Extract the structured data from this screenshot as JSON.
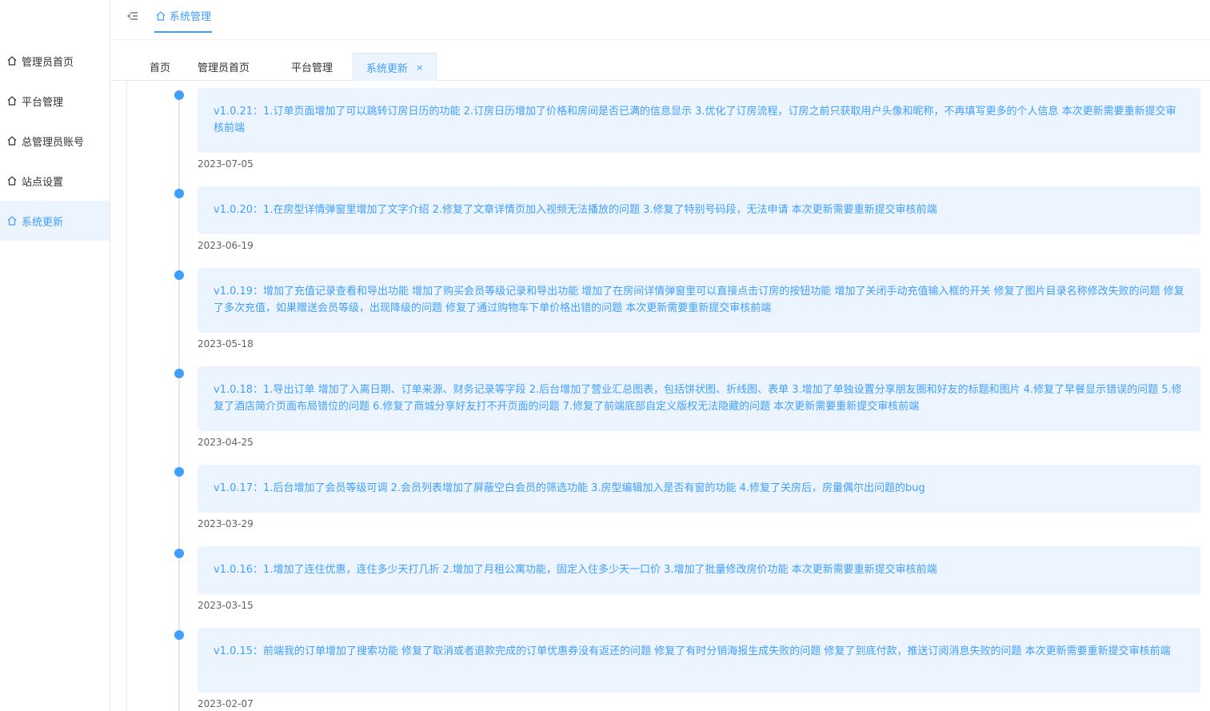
{
  "sidebar": {
    "items": [
      {
        "label": "管理员首页"
      },
      {
        "label": "平台管理"
      },
      {
        "label": "总管理员账号"
      },
      {
        "label": "站点设置"
      },
      {
        "label": "系统更新"
      }
    ],
    "active_index": 4
  },
  "topbar": {
    "tab_label": "系统管理"
  },
  "tags": {
    "items": [
      {
        "label": "首页"
      },
      {
        "label": "管理员首页"
      },
      {
        "label": "平台管理"
      },
      {
        "label": "系统更新"
      }
    ],
    "close_glyph": "×"
  },
  "timeline": [
    {
      "text": "v1.0.21：1.订单页面增加了可以跳转订房日历的功能 2.订房日历增加了价格和房间是否已满的信息显示 3.优化了订房流程，订房之前只获取用户头像和昵称，不再填写更多的个人信息 本次更新需要重新提交审核前端",
      "date": "2023-07-05"
    },
    {
      "text": "v1.0.20：1.在房型详情弹窗里增加了文字介绍 2.修复了文章详情页加入视频无法播放的问题 3.修复了特别号码段，无法申请 本次更新需要重新提交审核前端",
      "date": "2023-06-19"
    },
    {
      "text": "v1.0.19：增加了充值记录查看和导出功能 增加了购买会员等级记录和导出功能 增加了在房间详情弹窗里可以直接点击订房的按钮功能 增加了关闭手动充值输入框的开关 修复了图片目录名称修改失败的问题 修复了多次充值，如果赠送会员等级，出现降级的问题 修复了通过购物车下单价格出错的问题 本次更新需要重新提交审核前端",
      "date": "2023-05-18"
    },
    {
      "text": "v1.0.18：1.导出订单 增加了入离日期、订单来源、财务记录等字段 2.后台增加了营业汇总图表，包括饼状图、折线图、表单 3.增加了单独设置分享朋友圈和好友的标题和图片 4.修复了早餐显示错误的问题 5.修复了酒店简介页面布局错位的问题 6.修复了商城分享好友打不开页面的问题 7.修复了前端底部自定义版权无法隐藏的问题 本次更新需要重新提交审核前端",
      "date": "2023-04-25"
    },
    {
      "text": "v1.0.17：1.后台增加了会员等级可调 2.会员列表增加了屏蔽空白会员的筛选功能 3.房型编辑加入是否有窗的功能 4.修复了关房后，房量偶尔出问题的bug",
      "date": "2023-03-29"
    },
    {
      "text": "v1.0.16：1.增加了连住优惠，连住多少天打几折 2.增加了月租公寓功能，固定入住多少天一口价 3.增加了批量修改房价功能 本次更新需要重新提交审核前端",
      "date": "2023-03-15"
    },
    {
      "text": "v1.0.15：前端我的订单增加了搜索功能 修复了取消或者退款完成的订单优惠券没有返还的问题 修复了有时分销海报生成失败的问题 修复了到底付款，推送订阅消息失败的问题 本次更新需要重新提交审核前端",
      "date": "2023-02-07"
    }
  ],
  "colors": {
    "accent": "#409eff",
    "accent_bg": "#ecf5ff"
  }
}
